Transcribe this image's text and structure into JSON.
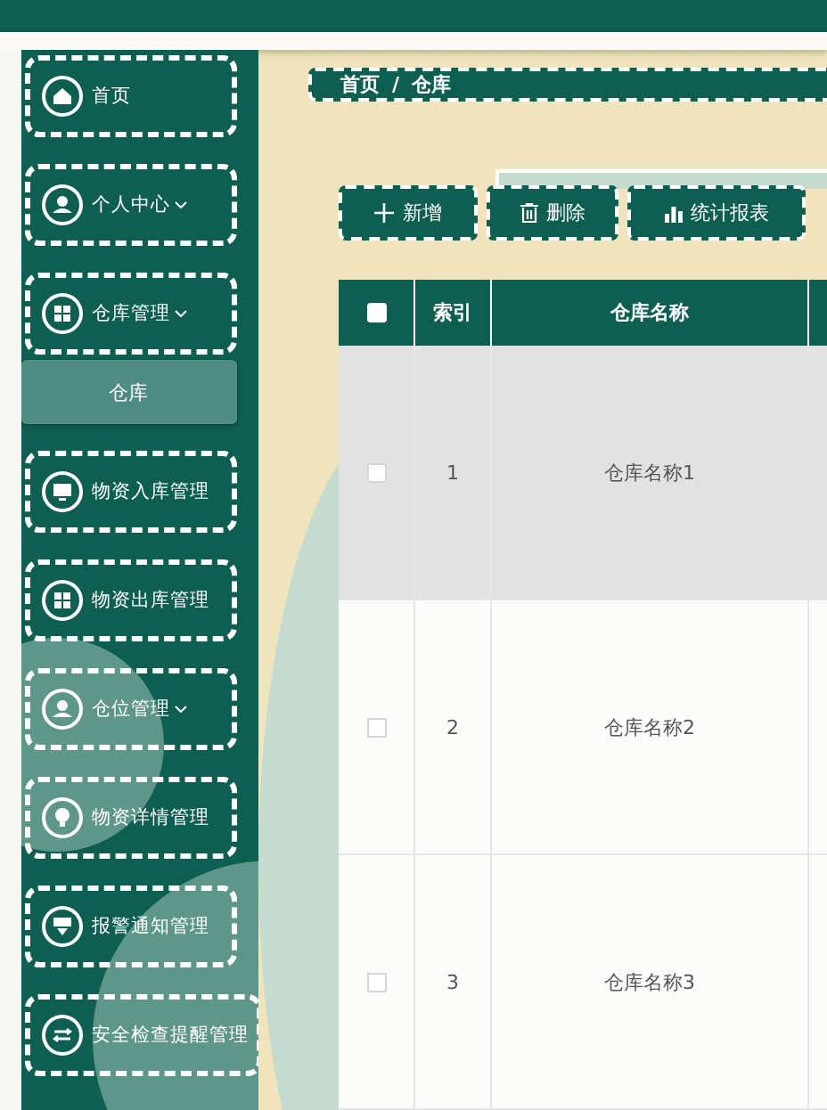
{
  "sidebar": {
    "items": [
      {
        "label": "首页",
        "kind": "home",
        "expandable": false,
        "selected": false
      },
      {
        "label": "个人中心",
        "kind": "user",
        "expandable": true,
        "selected": false
      },
      {
        "label": "仓库管理",
        "kind": "grid",
        "expandable": true,
        "selected": false,
        "children": [
          {
            "label": "仓库",
            "selected": true
          }
        ]
      },
      {
        "label": "物资入库管理",
        "kind": "monitor",
        "expandable": false,
        "selected": false
      },
      {
        "label": "物资出库管理",
        "kind": "grid",
        "expandable": false,
        "selected": false
      },
      {
        "label": "仓位管理",
        "kind": "user",
        "expandable": true,
        "selected": false
      },
      {
        "label": "物资详情管理",
        "kind": "bulb",
        "expandable": false,
        "selected": false
      },
      {
        "label": "报警通知管理",
        "kind": "sign",
        "expandable": false,
        "selected": false
      },
      {
        "label": "安全检查提醒管理",
        "kind": "switch",
        "expandable": false,
        "selected": false
      }
    ]
  },
  "breadcrumb": [
    "首页",
    "仓库"
  ],
  "breadcrumb_separator": "/",
  "toolbar": [
    {
      "label": "新增",
      "kind": "add"
    },
    {
      "label": "删除",
      "kind": "delete"
    },
    {
      "label": "统计报表",
      "kind": "chart"
    }
  ],
  "table": {
    "all_checked": false,
    "columns": [
      "索引",
      "仓库名称"
    ],
    "rows": [
      {
        "index": "1",
        "name": "仓库名称1",
        "checked": false,
        "highlighted": true
      },
      {
        "index": "2",
        "name": "仓库名称2",
        "checked": false,
        "highlighted": false
      },
      {
        "index": "3",
        "name": "仓库名称3",
        "checked": false,
        "highlighted": false
      }
    ]
  }
}
